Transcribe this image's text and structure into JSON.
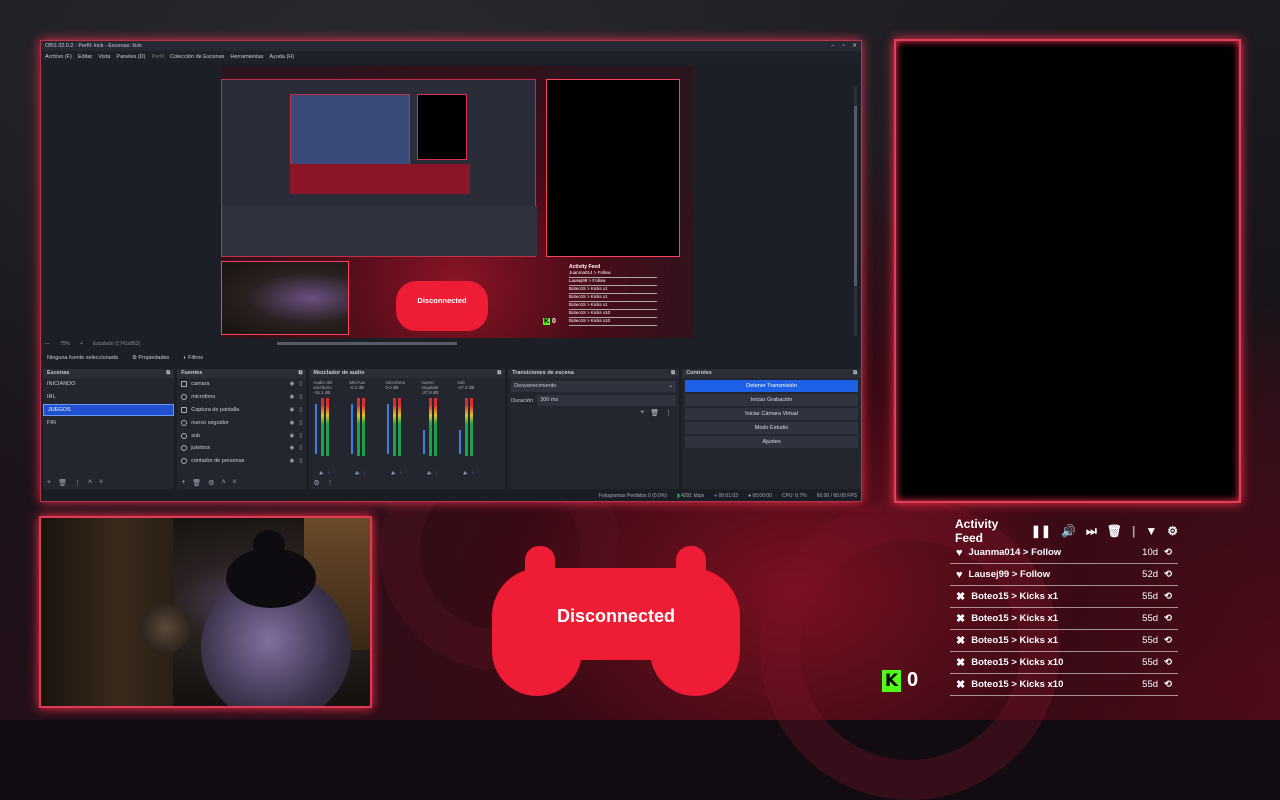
{
  "obs": {
    "title": "OBS 32.0.2 - Perfil: kick - Escenas: kick",
    "menu": [
      "Archivo (F)",
      "Editar",
      "Vista",
      "Paneles (D)",
      "Perfil",
      "Colección de Escenas",
      "Herramientas",
      "Ayuda (H)"
    ],
    "zoom": "75%",
    "scale": "Escalado (1741x862)",
    "no_source": "Ninguna fuente seleccionada",
    "properties": "Propiedades",
    "filters": "Filtros",
    "scenes_title": "Escenas",
    "scenes": [
      "INICIANDO",
      "IRL",
      "JUEGOS",
      "FIN"
    ],
    "sources_title": "Fuentes",
    "sources": [
      "camara",
      "microfono",
      "Captura de pantalla",
      "nuevo seguidor",
      "sub",
      "jukebox",
      "contador de personas"
    ],
    "mixer_title": "Mezclador de audio",
    "mixer": [
      {
        "name": "Audio del escritorio",
        "db": "-16.1 dB"
      },
      {
        "name": "Mic/Aux",
        "db": "-0.2 dB"
      },
      {
        "name": "microfono",
        "db": "0.0 dB"
      },
      {
        "name": "nuevo seguidor",
        "db": "-27.9 dB"
      },
      {
        "name": "sub",
        "db": "-27.0 dB"
      }
    ],
    "transitions_title": "Transiciones de escena",
    "transition": "Desvanecimiento",
    "duration_label": "Duración",
    "duration": "300 ms",
    "controls_title": "Controles",
    "controls": [
      "Detener Transmisión",
      "Iniciar Grabación",
      "Iniciar Cámara Virtual",
      "Modo Estudio",
      "Ajustes"
    ],
    "status": {
      "dropped": "Fotogramas Perdidos 0 (0.0%)",
      "bitrate": "4291 kbps",
      "live": "00:01:03",
      "rec": "00:00:00",
      "cpu": "CPU: 0.7%",
      "fps": "60.00 / 60.00 FPS"
    }
  },
  "overlay": {
    "disconnected": "Disconnected",
    "kick_count": "0",
    "kick_letter": "K",
    "accent": "#ee1c34"
  },
  "activity_feed": {
    "title": "Activity Feed",
    "items": [
      {
        "icon": "heart-icon",
        "text": "Juanma014 > Follow",
        "time": "10d"
      },
      {
        "icon": "heart-icon",
        "text": "Lausej99 > Follow",
        "time": "52d"
      },
      {
        "icon": "kick-icon",
        "text": "Boteo15 > Kicks x1",
        "time": "55d"
      },
      {
        "icon": "kick-icon",
        "text": "Boteo15 > Kicks x1",
        "time": "55d"
      },
      {
        "icon": "kick-icon",
        "text": "Boteo15 > Kicks x1",
        "time": "55d"
      },
      {
        "icon": "kick-icon",
        "text": "Boteo15 > Kicks x10",
        "time": "55d"
      },
      {
        "icon": "kick-icon",
        "text": "Boteo15 > Kicks x10",
        "time": "55d"
      }
    ]
  }
}
